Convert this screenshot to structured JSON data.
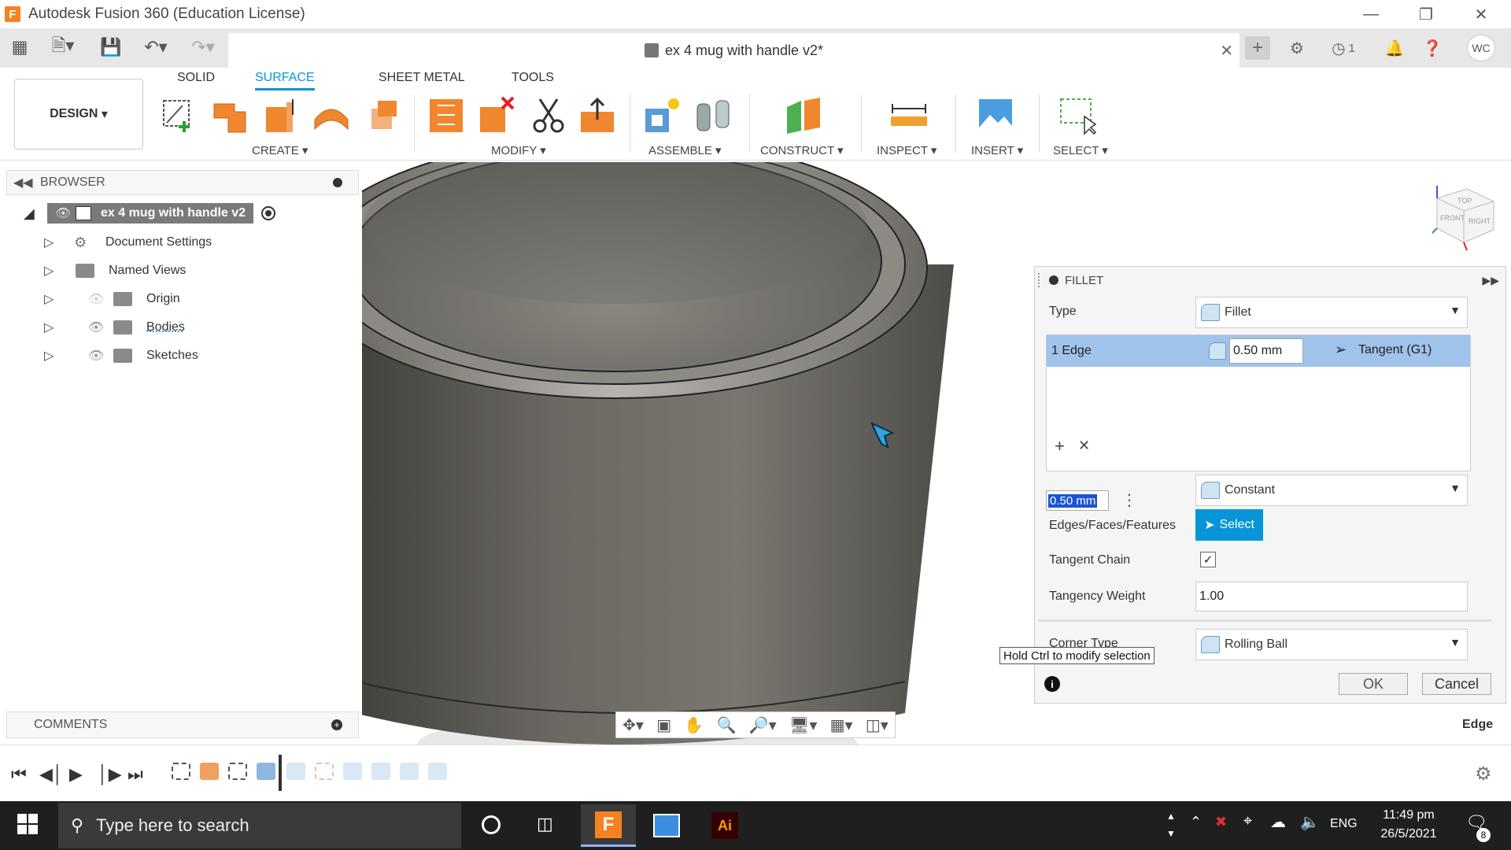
{
  "window": {
    "title": "Autodesk Fusion 360 (Education License)"
  },
  "document": {
    "tab_title": "ex 4 mug with handle v2*"
  },
  "quick_access": {
    "notifications_count": "1",
    "user_initials": "WC"
  },
  "ribbon": {
    "tabs": [
      "SOLID",
      "SURFACE",
      "SHEET METAL",
      "TOOLS"
    ],
    "active_tab": "SURFACE",
    "workspace": "DESIGN",
    "groups": [
      "CREATE",
      "MODIFY",
      "ASSEMBLE",
      "CONSTRUCT",
      "INSPECT",
      "INSERT",
      "SELECT"
    ]
  },
  "browser": {
    "title": "BROWSER",
    "root": "ex 4 mug with handle v2",
    "items": [
      "Document Settings",
      "Named Views",
      "Origin",
      "Bodies",
      "Sketches"
    ]
  },
  "comments": {
    "title": "COMMENTS"
  },
  "fillet": {
    "title": "FILLET",
    "type_label": "Type",
    "type_value": "Fillet",
    "edge_row": {
      "name": "1 Edge",
      "radius": "0.50 mm",
      "continuity": "Tangent (G1)"
    },
    "radius_input": "0.50 mm",
    "radius_type_value": "Constant",
    "edges_label": "Edges/Faces/Features",
    "select_button": "Select",
    "tangent_chain_label": "Tangent Chain",
    "tangent_chain_checked": true,
    "tangency_weight_label": "Tangency Weight",
    "tangency_weight_value": "1.00",
    "corner_type_label": "Corner Type",
    "corner_type_value": "Rolling Ball",
    "tooltip": "Hold Ctrl to modify selection",
    "ok": "OK",
    "cancel": "Cancel"
  },
  "status": {
    "selection": "Edge"
  },
  "viewcube": {
    "right": "RIGHT",
    "front": "FRONT",
    "top": "TOP"
  },
  "taskbar": {
    "search_placeholder": "Type here to search",
    "language": "ENG",
    "time": "11:49 pm",
    "date": "26/5/2021",
    "notification_count": "8"
  }
}
